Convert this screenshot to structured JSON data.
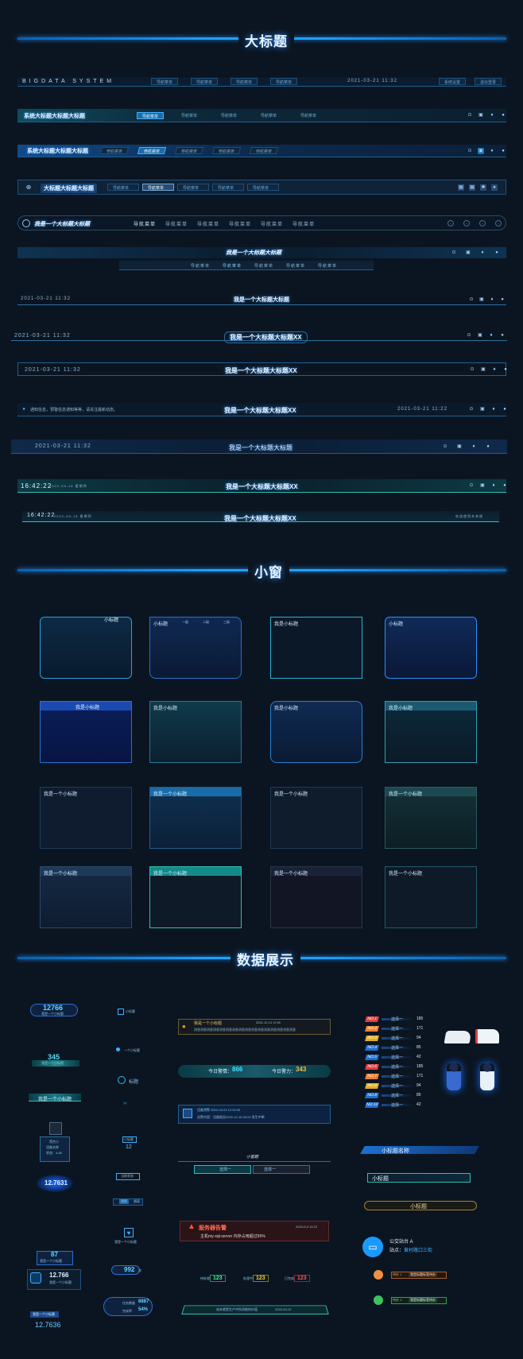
{
  "sections": {
    "headers": "大标题",
    "windows": "小窗",
    "data": "数据展示"
  },
  "h1": {
    "brand": "BIGDATA SYSTEM",
    "nav": [
      "导航菜单",
      "导航菜单",
      "导航菜单",
      "导航菜单"
    ],
    "date": "2021-03-21 11:32",
    "btn": "系统设置",
    "btn2": "退出登录"
  },
  "h2": {
    "title": "系统大标题大标题大标题",
    "nav": [
      "导航菜单",
      "导航菜单",
      "导航菜单",
      "导航菜单",
      "导航菜单"
    ]
  },
  "h3": {
    "title": "系统大标题大标题大标题",
    "nav": [
      "导航菜单",
      "导航菜单",
      "导航菜单",
      "导航菜单",
      "导航菜单"
    ]
  },
  "h4": {
    "title": "大标题大标题大标题",
    "nav": [
      "导航菜单",
      "导航菜单",
      "导航菜单",
      "导航菜单",
      "导航菜单"
    ]
  },
  "h5": {
    "title": "我是一个大标题大标题",
    "nav": [
      "导航菜单",
      "导航菜单",
      "导航菜单",
      "导航菜单",
      "导航菜单",
      "导航菜单"
    ]
  },
  "h6": {
    "title": "我是一个大标题大标题",
    "nav": [
      "导航菜单",
      "导航菜单",
      "导航菜单",
      "导航菜单",
      "导航菜单"
    ]
  },
  "h7": {
    "date": "2021-03-21 11:32",
    "title": "我是一个大标题大标题"
  },
  "h8": {
    "date": "2021-03-21 11:32",
    "title": "我是一个大标题大标题XX"
  },
  "h9": {
    "date": "2021-03-21 11:32",
    "title": "我是一个大标题大标题XX"
  },
  "h10": {
    "notice": "通知信息，预警信息通知等等，请关注最新动态。",
    "title": "我是一个大标题大标题XX",
    "date": "2021-03-21 11:22"
  },
  "h11": {
    "date": "2021-03-21 11:32",
    "title": "我是一个大标题大标题"
  },
  "h12": {
    "time": "16:42:22",
    "date": "2022-05-18 星期四",
    "title": "我是一个大标题大标题XX"
  },
  "h13": {
    "time": "16:42:22",
    "date": "2022-05-18 星期四",
    "title": "我是一个大标题大标题XX",
    "user": "欢迎使用本系统"
  },
  "win_titles": [
    "小标题",
    "小标题",
    "我是小标题",
    "小标题",
    "我是小标题",
    "我是小标题",
    "我是小标题",
    "我是小标题",
    "我是一个小标题",
    "我是一个小标题",
    "我是一个小标题",
    "我是一个小标题",
    "我是一个小标题",
    "我是一个小标题",
    "我是一个小标题",
    "我是一个小标题"
  ],
  "w2tabs": [
    "一级",
    "二级",
    "三级"
  ],
  "left": {
    "n1": "12766",
    "l1": "我是一个小标题",
    "n2": "345",
    "l2": "我是一个小标题",
    "l3": "我是一个小标题",
    "dev1": "黑色小",
    "dev2": "设备名称",
    "dev3": "状态：4.48",
    "n4": "12.7631",
    "n5": "87",
    "l5": "我是一个小标题",
    "n6": "12.766",
    "l6": "我是一个小标题",
    "l7": "我是一个小标题",
    "n7": "12.7636"
  },
  "mid1": {
    "a": "小标题",
    "b": "一个小标题",
    "c": "标题",
    "d": "小标题",
    "e": "12",
    "f": "当前状态",
    "g": "预警",
    "h": "隔离",
    "i": "我是一个小标题",
    "j": "992",
    "k": "次"
  },
  "mid2": {
    "alert_title": "我是一个小标题",
    "alert_date": "2021.12.13 12:00",
    "alert_text": "消息消息消息消息消息消息消息消息消息消息消息消息消息消息消息消息",
    "t1": "今日警情：",
    "v1": "866",
    "t2": "今日警力：",
    "v2": "343",
    "notice_title": "设备预警  2022-03-02  12:03:30",
    "notice_text": "告警内容：设备报告2022-12-16 03:22 发生中断",
    "tab_title": "小窗题",
    "sel1": "选择一",
    "sel2": "选择一",
    "srv_title": "服务器告警",
    "srv_date": "2023-9-3 11:23",
    "srv_text": "主机my-sql-server 内存占用超过95%",
    "b1": "123",
    "b2": "123",
    "b3": "123",
    "bl1": "待处理",
    "bl2": "处理中",
    "bl3": "已完成",
    "footer": "成本就是生产中所消耗的价值",
    "footer_date": "2022-03-12",
    "stats_l1": "任务数量",
    "stats_v1": "8887",
    "stats_l2": "完成率",
    "stats_v2": "54%"
  },
  "ranks": [
    [
      "NO.1",
      "选择一",
      "185"
    ],
    [
      "NO.2",
      "选择一",
      "171"
    ],
    [
      "NO.3",
      "选择一",
      "94"
    ],
    [
      "NO.4",
      "选择一",
      "85"
    ],
    [
      "NO.5",
      "选择一",
      "42"
    ],
    [
      "NO.6",
      "选择一",
      "185"
    ],
    [
      "NO.7",
      "选择一",
      "171"
    ],
    [
      "NO.8",
      "选择一",
      "94"
    ],
    [
      "NO.9",
      "选择一",
      "85"
    ],
    [
      "NO.10",
      "选择一",
      "42"
    ]
  ],
  "right": {
    "t1": "小标题名称",
    "t2": "小标题",
    "t3": "小标题",
    "bus_name": "公交站台 A",
    "bus_site": "站点：",
    "bus_site_val": "黄村路口三街",
    "tag1": "待办 1",
    "tag1v": "我是标题标签待办",
    "tag2": "待办 1",
    "tag2v": "我是标题标签待办"
  }
}
